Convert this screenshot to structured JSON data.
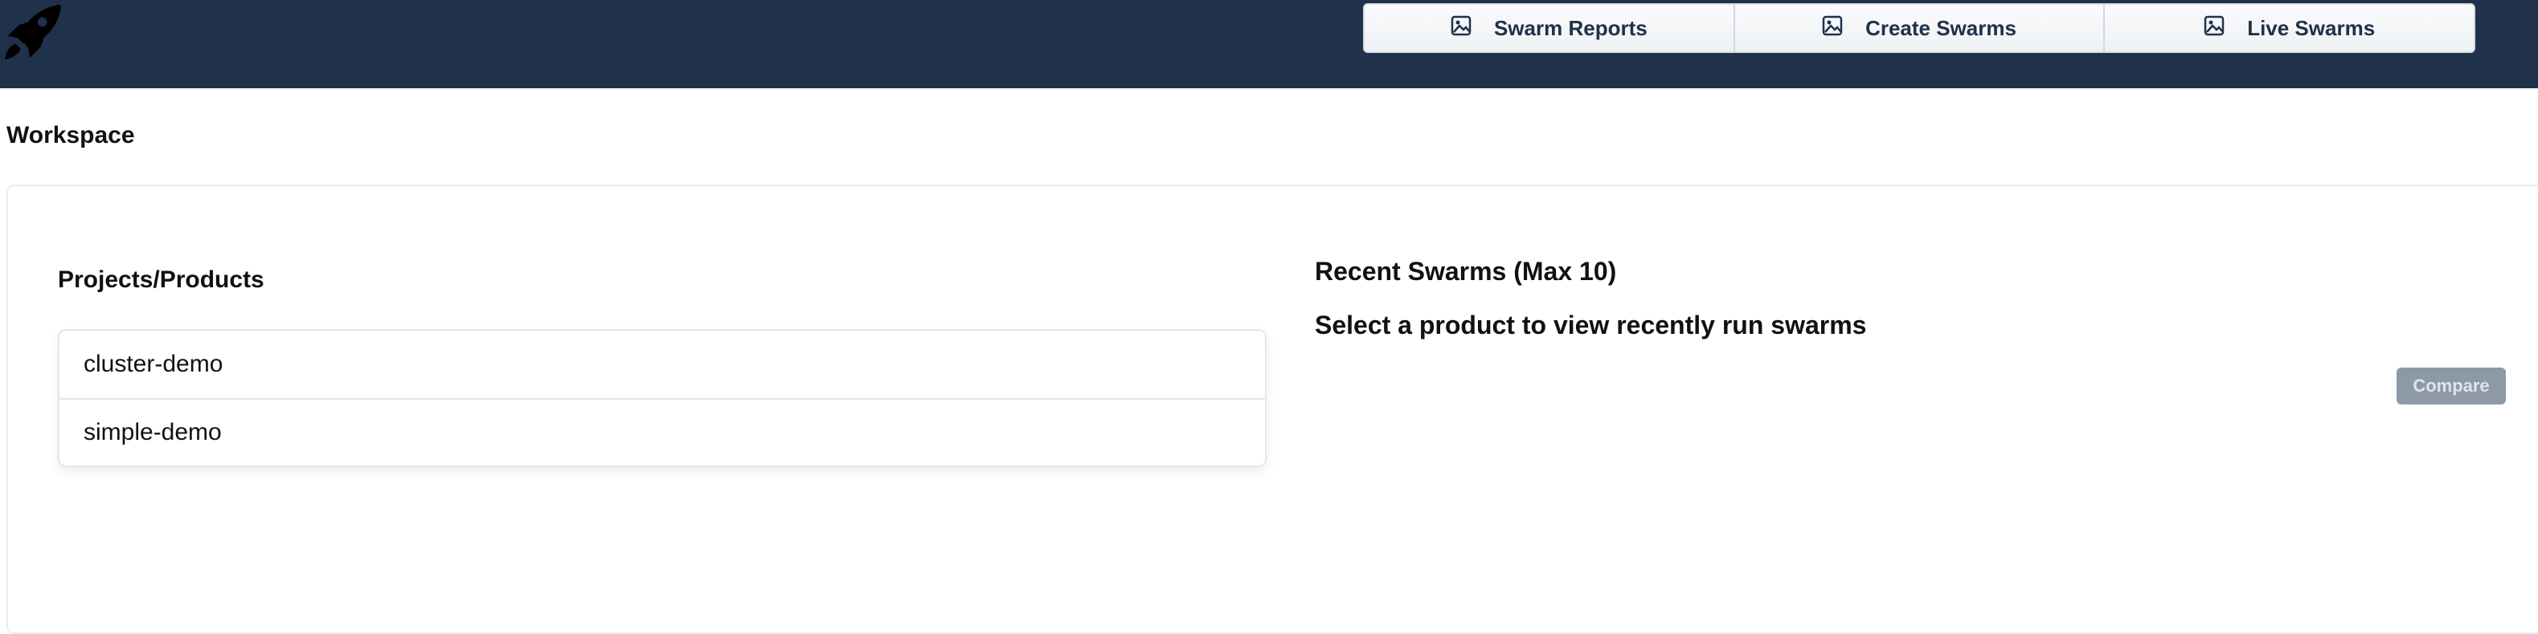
{
  "header": {
    "logo_icon": "rocket-icon",
    "nav": [
      {
        "label": "Swarm Reports",
        "icon": "image-icon"
      },
      {
        "label": "Create Swarms",
        "icon": "image-icon"
      },
      {
        "label": "Live Swarms",
        "icon": "image-icon"
      }
    ]
  },
  "page": {
    "title": "Workspace"
  },
  "projects": {
    "heading": "Projects/Products",
    "items": [
      {
        "label": "cluster-demo"
      },
      {
        "label": "simple-demo"
      }
    ]
  },
  "recent": {
    "heading": "Recent Swarms (Max 10)",
    "hint": "Select a product to view recently run swarms",
    "compare_label": "Compare"
  },
  "colors": {
    "header_bg": "#20314a",
    "compare_disabled_bg": "#8d99a6"
  }
}
